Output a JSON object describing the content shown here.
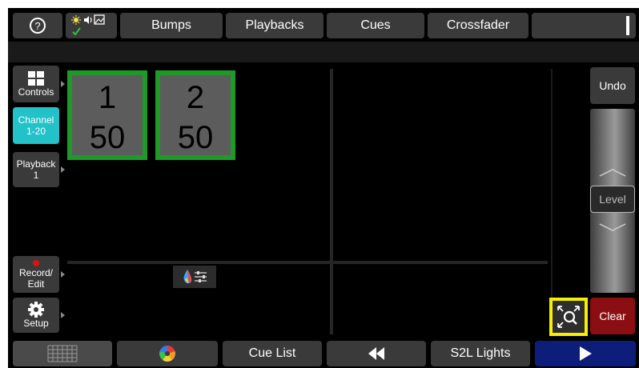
{
  "topbar": {
    "help_icon": "question-circle-icon",
    "status_icons": [
      "light-bulb-icon",
      "speaker-icon",
      "image-icon",
      "check-icon"
    ],
    "tabs": [
      "Bumps",
      "Playbacks",
      "Cues",
      "Crossfader"
    ]
  },
  "sidebar": {
    "controls": "Controls",
    "channel": [
      "Channel",
      "1-20"
    ],
    "playback": [
      "Playback",
      "1"
    ],
    "record": [
      "Record/",
      "Edit"
    ],
    "setup": "Setup"
  },
  "tiles": [
    {
      "channel": "1",
      "level": "50"
    },
    {
      "channel": "2",
      "level": "50"
    }
  ],
  "right": {
    "undo": "Undo",
    "level": "Level",
    "clear": "Clear",
    "zoom_icon": "zoom-expand-icon"
  },
  "bottombar": {
    "grid_icon": "grid-icon",
    "color_icon": "color-wheel-icon",
    "cue_list": "Cue List",
    "rewind_icon": "rewind-icon",
    "s2l": "S2L Lights",
    "play_icon": "play-icon"
  },
  "colors": {
    "accent_teal": "#22c2c8",
    "tile_border": "#1e9a28",
    "clear_red": "#8b0f12",
    "highlight_yellow": "#f5f000",
    "play_blue": "#0c1d7a"
  }
}
